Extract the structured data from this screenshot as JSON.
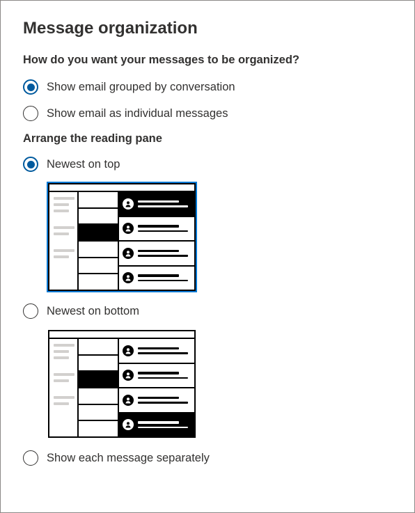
{
  "title": "Message organization",
  "group1": {
    "heading": "How do you want your messages to be organized?",
    "options": [
      {
        "label": "Show email grouped by conversation",
        "selected": true
      },
      {
        "label": "Show email as individual messages",
        "selected": false
      }
    ]
  },
  "group2": {
    "heading": "Arrange the reading pane",
    "options": [
      {
        "label": "Newest on top",
        "selected": true,
        "preview": "top"
      },
      {
        "label": "Newest on bottom",
        "selected": false,
        "preview": "bottom"
      },
      {
        "label": "Show each message separately",
        "selected": false
      }
    ]
  }
}
